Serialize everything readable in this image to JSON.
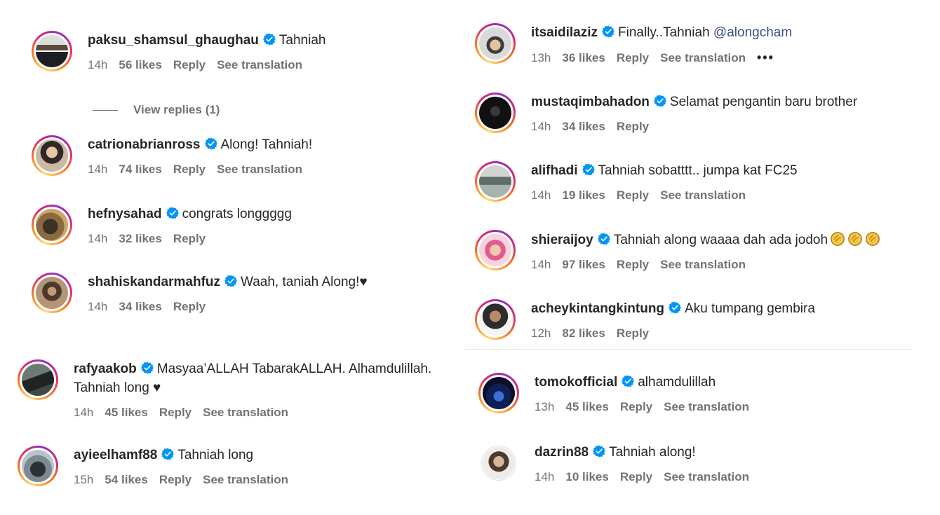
{
  "view_replies_label": "View replies (1)",
  "comments": [
    {
      "username": "paksu_shamsul_ghaughau",
      "text": "Tahniah",
      "time": "14h",
      "likes": "56 likes",
      "reply": "Reply",
      "translate": "See translation"
    },
    {
      "username": "catrionabrianross",
      "text": "Along! Tahniah!",
      "time": "14h",
      "likes": "74 likes",
      "reply": "Reply",
      "translate": "See translation"
    },
    {
      "username": "hefnysahad",
      "text": "congrats longgggg",
      "time": "14h",
      "likes": "32 likes",
      "reply": "Reply"
    },
    {
      "username": "shahiskandarmahfuz",
      "text": "Waah, taniah Along!",
      "suffix": "♥",
      "time": "14h",
      "likes": "34 likes",
      "reply": "Reply"
    },
    {
      "username": "rafyaakob",
      "text": "Masyaa’ALLAH TabarakALLAH. Alhamdulillah.",
      "text2": "Tahniah long ♥",
      "time": "14h",
      "likes": "45 likes",
      "reply": "Reply",
      "translate": "See translation"
    },
    {
      "username": "ayieelhamf88",
      "text": "Tahniah long",
      "time": "15h",
      "likes": "54 likes",
      "reply": "Reply",
      "translate": "See translation"
    },
    {
      "username": "itsaidilaziz",
      "text": "Finally..Tahniah",
      "mention": "@alongcham",
      "time": "13h",
      "likes": "36 likes",
      "reply": "Reply",
      "translate": "See translation",
      "more": "•••"
    },
    {
      "username": "mustaqimbahadon",
      "text": "Selamat pengantin baru brother",
      "time": "14h",
      "likes": "34 likes",
      "reply": "Reply"
    },
    {
      "username": "alifhadi",
      "text": "Tahniah sobatttt.. jumpa kat FC25",
      "time": "14h",
      "likes": "19 likes",
      "reply": "Reply",
      "translate": "See translation"
    },
    {
      "username": "shieraijoy",
      "text": "Tahniah along waaaa dah ada jodoh",
      "time": "14h",
      "likes": "97 likes",
      "reply": "Reply",
      "translate": "See translation"
    },
    {
      "username": "acheykintangkintung",
      "text": "Aku tumpang gembira",
      "time": "12h",
      "likes": "82 likes",
      "reply": "Reply"
    },
    {
      "username": "tomokofficial",
      "text": "alhamdulillah",
      "time": "13h",
      "likes": "45 likes",
      "reply": "Reply",
      "translate": "See translation"
    },
    {
      "username": "dazrin88",
      "text": "Tahniah along!",
      "time": "14h",
      "likes": "10 likes",
      "reply": "Reply",
      "translate": "See translation"
    }
  ],
  "colors": {
    "verified": "#0095f6",
    "meta": "#737373",
    "text": "#262626",
    "mention": "#385185"
  }
}
